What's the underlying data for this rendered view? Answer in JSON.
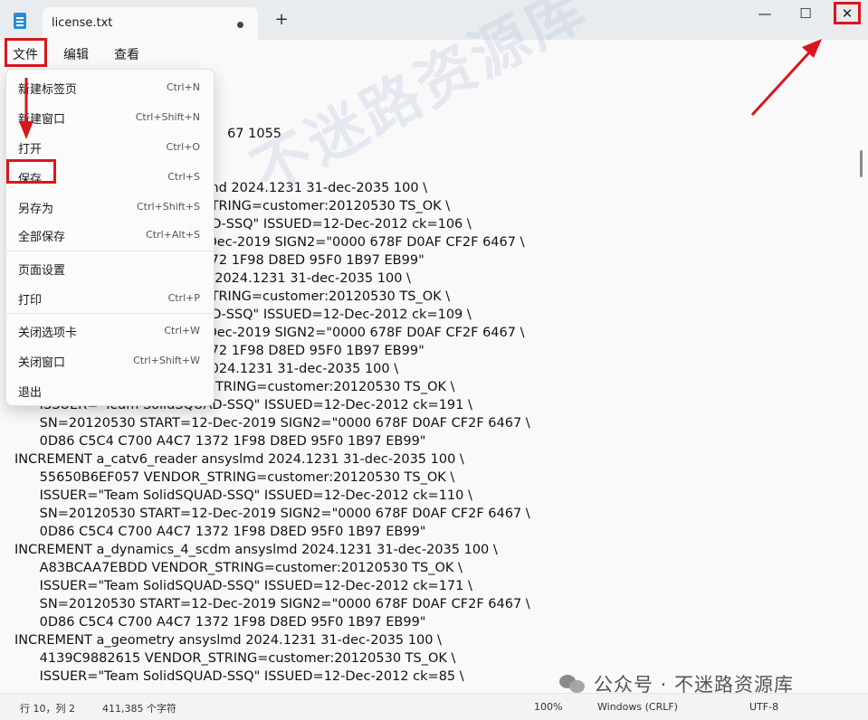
{
  "titlebar": {
    "tab_title": "license.txt",
    "new_tab": "+",
    "minimize": "—",
    "maximize": "☐",
    "close": "✕"
  },
  "menubar": {
    "file": "文件",
    "edit": "编辑",
    "view": "查看",
    "settings_icon": "⚙"
  },
  "dropdown": {
    "items": [
      {
        "label": "新建标签页",
        "shortcut": "Ctrl+N"
      },
      {
        "label": "新建窗口",
        "shortcut": "Ctrl+Shift+N"
      },
      {
        "label": "打开",
        "shortcut": "Ctrl+O"
      },
      {
        "label": "保存",
        "shortcut": "Ctrl+S"
      },
      {
        "label": "另存为",
        "shortcut": "Ctrl+Shift+S"
      },
      {
        "label": "全部保存",
        "shortcut": "Ctrl+Alt+S"
      },
      {
        "label": "页面设置",
        "shortcut": ""
      },
      {
        "label": "打印",
        "shortcut": "Ctrl+P"
      },
      {
        "label": "关闭选项卡",
        "shortcut": "Ctrl+W"
      },
      {
        "label": "关闭窗口",
        "shortcut": "Ctrl+Shift+W"
      },
      {
        "label": "退出",
        "shortcut": ""
      }
    ]
  },
  "editor": {
    "text": "                                                   67 1055\n\n\n                                             lmd 2024.1231 31-dec-2035 100 \\\n                                             STRING=customer:20120530 TS_OK \\\n                                             AD-SSQ\" ISSUED=12-Dec-2012 ck=106 \\\n                                             -Dec-2019 SIGN2=\"0000 678F D0AF CF2F 6467 \\\n                                             372 1F98 D8ED 95F0 1B97 EB99\"\n                                             d 2024.1231 31-dec-2035 100 \\\n                                             STRING=customer:20120530 TS_OK \\\n                                             AD-SSQ\" ISSUED=12-Dec-2012 ck=109 \\\n                                             -Dec-2019 SIGN2=\"0000 678F D0AF CF2F 6467 \\\n                                             372 1F98 D8ED 95F0 1B97 EB99\"\n                                             2024.1231 31-dec-2035 100 \\\n      9B0FD017F1F9 VENDOR_STRING=customer:20120530 TS_OK \\\n      ISSUER=\"Team SolidSQUAD-SSQ\" ISSUED=12-Dec-2012 ck=191 \\\n      SN=20120530 START=12-Dec-2019 SIGN2=\"0000 678F D0AF CF2F 6467 \\\n      0D86 C5C4 C700 A4C7 1372 1F98 D8ED 95F0 1B97 EB99\"\nINCREMENT a_catv6_reader ansyslmd 2024.1231 31-dec-2035 100 \\\n      55650B6EF057 VENDOR_STRING=customer:20120530 TS_OK \\\n      ISSUER=\"Team SolidSQUAD-SSQ\" ISSUED=12-Dec-2012 ck=110 \\\n      SN=20120530 START=12-Dec-2019 SIGN2=\"0000 678F D0AF CF2F 6467 \\\n      0D86 C5C4 C700 A4C7 1372 1F98 D8ED 95F0 1B97 EB99\"\nINCREMENT a_dynamics_4_scdm ansyslmd 2024.1231 31-dec-2035 100 \\\n      A83BCAA7EBDD VENDOR_STRING=customer:20120530 TS_OK \\\n      ISSUER=\"Team SolidSQUAD-SSQ\" ISSUED=12-Dec-2012 ck=171 \\\n      SN=20120530 START=12-Dec-2019 SIGN2=\"0000 678F D0AF CF2F 6467 \\\n      0D86 C5C4 C700 A4C7 1372 1F98 D8ED 95F0 1B97 EB99\"\nINCREMENT a_geometry ansyslmd 2024.1231 31-dec-2035 100 \\\n      4139C9882615 VENDOR_STRING=customer:20120530 TS_OK \\\n      ISSUER=\"Team SolidSQUAD-SSQ\" ISSUED=12-Dec-2012 ck=85 \\"
  },
  "statusbar": {
    "position": "行 10，列 2",
    "char_count": "411,385 个字符",
    "zoom": "100%",
    "line_ending": "Windows (CRLF)",
    "encoding": "UTF-8"
  },
  "watermark": "不迷路资源库",
  "wechat_label": "公众号 · 不迷路资源库",
  "colors": {
    "highlight_red": "#d9161d",
    "accent_blue": "#2a8bd6"
  }
}
